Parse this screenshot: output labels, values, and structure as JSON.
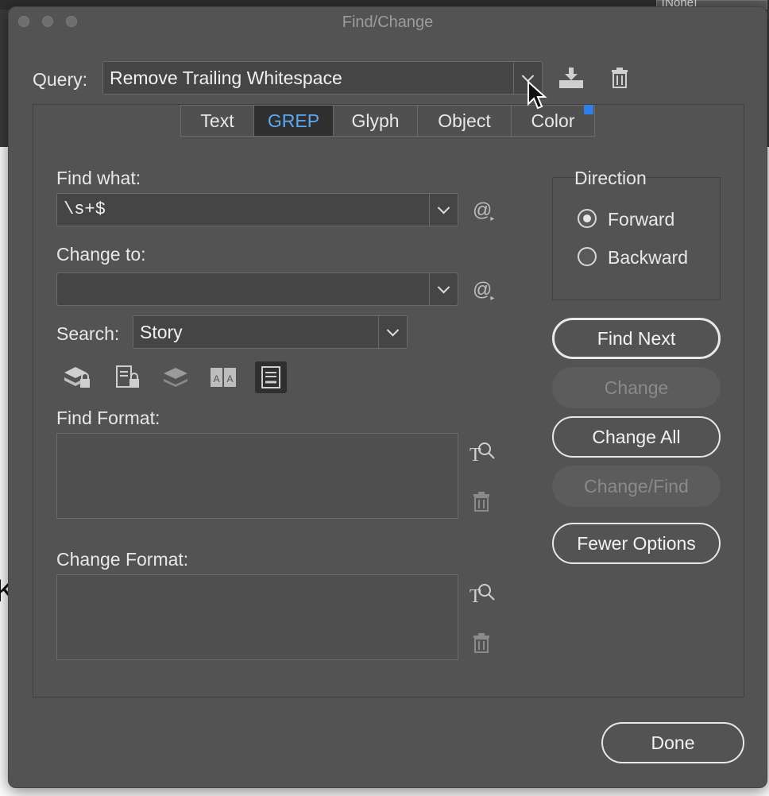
{
  "window": {
    "title": "Find/Change"
  },
  "background": {
    "none_label": "[None]"
  },
  "query": {
    "label": "Query:",
    "value": "Remove Trailing Whitespace",
    "save_icon": "save-query-icon",
    "delete_icon": "trash-icon"
  },
  "tabs": [
    {
      "label": "Text",
      "active": false
    },
    {
      "label": "GREP",
      "active": true
    },
    {
      "label": "Glyph",
      "active": false
    },
    {
      "label": "Object",
      "active": false
    },
    {
      "label": "Color",
      "active": false
    }
  ],
  "find": {
    "label": "Find what:",
    "value": "\\s+$",
    "special_icon": "@"
  },
  "change": {
    "label": "Change to:",
    "value": "",
    "special_icon": "@"
  },
  "search": {
    "label": "Search:",
    "value": "Story"
  },
  "options": [
    {
      "icon": "include-locked-layers-icon",
      "on": false
    },
    {
      "icon": "include-locked-stories-icon",
      "on": false
    },
    {
      "icon": "include-hidden-layers-icon",
      "on": false
    },
    {
      "icon": "include-master-pages-icon",
      "on": false
    },
    {
      "icon": "include-footnotes-icon",
      "on": true
    }
  ],
  "find_format": {
    "label": "Find Format:"
  },
  "change_format": {
    "label": "Change Format:"
  },
  "direction": {
    "label": "Direction",
    "forward": "Forward",
    "backward": "Backward",
    "selected": "Forward"
  },
  "buttons": {
    "find_next": "Find Next",
    "change": "Change",
    "change_all": "Change All",
    "change_find": "Change/Find",
    "fewer_options": "Fewer Options",
    "done": "Done"
  },
  "colors": {
    "active_tab": "#5fa8f0",
    "dialog_bg": "#535353",
    "accent_corner": "#2f7fe8"
  }
}
